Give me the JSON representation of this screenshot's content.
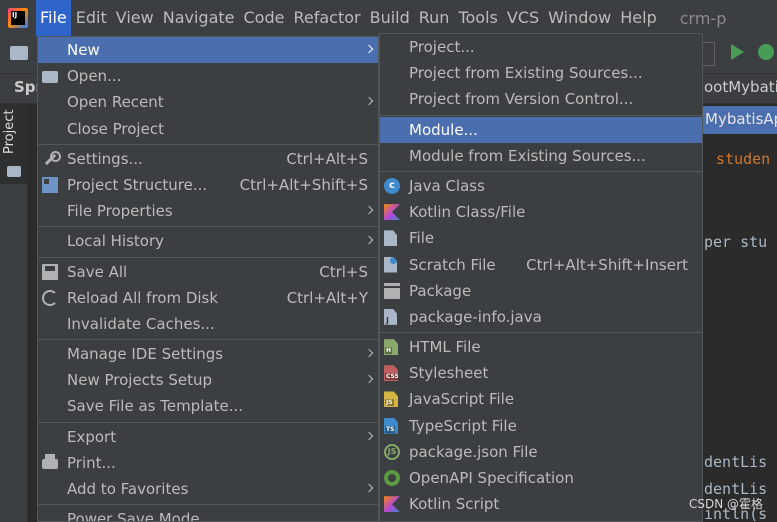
{
  "app": {
    "logo_text": "IJ",
    "window_title": "crm-p"
  },
  "menubar": [
    {
      "label": "File",
      "active": true
    },
    {
      "label": "Edit"
    },
    {
      "label": "View"
    },
    {
      "label": "Navigate"
    },
    {
      "label": "Code"
    },
    {
      "label": "Refactor"
    },
    {
      "label": "Build"
    },
    {
      "label": "Run"
    },
    {
      "label": "Tools"
    },
    {
      "label": "VCS"
    },
    {
      "label": "Window"
    },
    {
      "label": "Help"
    }
  ],
  "background": {
    "tab_left": "Spr",
    "tab_right": "ootMybati",
    "project_tab": "Project",
    "breadcrumb_right": "MybatisAp",
    "code_lines": [
      "studen",
      "per stu",
      "dentLis",
      "dentLis",
      "intln(s"
    ],
    "watermark": "CSDN @霍格"
  },
  "file_menu": {
    "new": "New",
    "open": "Open...",
    "open_recent": "Open Recent",
    "close_project": "Close Project",
    "settings": "Settings...",
    "settings_shortcut": "Ctrl+Alt+S",
    "project_structure": "Project Structure...",
    "project_structure_shortcut": "Ctrl+Alt+Shift+S",
    "file_properties": "File Properties",
    "local_history": "Local History",
    "save_all": "Save All",
    "save_all_shortcut": "Ctrl+S",
    "reload": "Reload All from Disk",
    "reload_shortcut": "Ctrl+Alt+Y",
    "invalidate": "Invalidate Caches...",
    "manage_ide": "Manage IDE Settings",
    "new_projects_setup": "New Projects Setup",
    "save_template": "Save File as Template...",
    "export": "Export",
    "print": "Print...",
    "add_favorites": "Add to Favorites",
    "power_save": "Power Save Mode"
  },
  "new_menu": {
    "project": "Project...",
    "project_existing": "Project from Existing Sources...",
    "project_vcs": "Project from Version Control...",
    "module": "Module...",
    "module_existing": "Module from Existing Sources...",
    "java_class": "Java Class",
    "kotlin_class": "Kotlin Class/File",
    "file": "File",
    "scratch_file": "Scratch File",
    "scratch_shortcut": "Ctrl+Alt+Shift+Insert",
    "package": "Package",
    "package_info": "package-info.java",
    "html_file": "HTML File",
    "stylesheet": "Stylesheet",
    "js_file": "JavaScript File",
    "ts_file": "TypeScript File",
    "package_json": "package.json File",
    "openapi": "OpenAPI Specification",
    "kotlin_script": "Kotlin Script"
  }
}
